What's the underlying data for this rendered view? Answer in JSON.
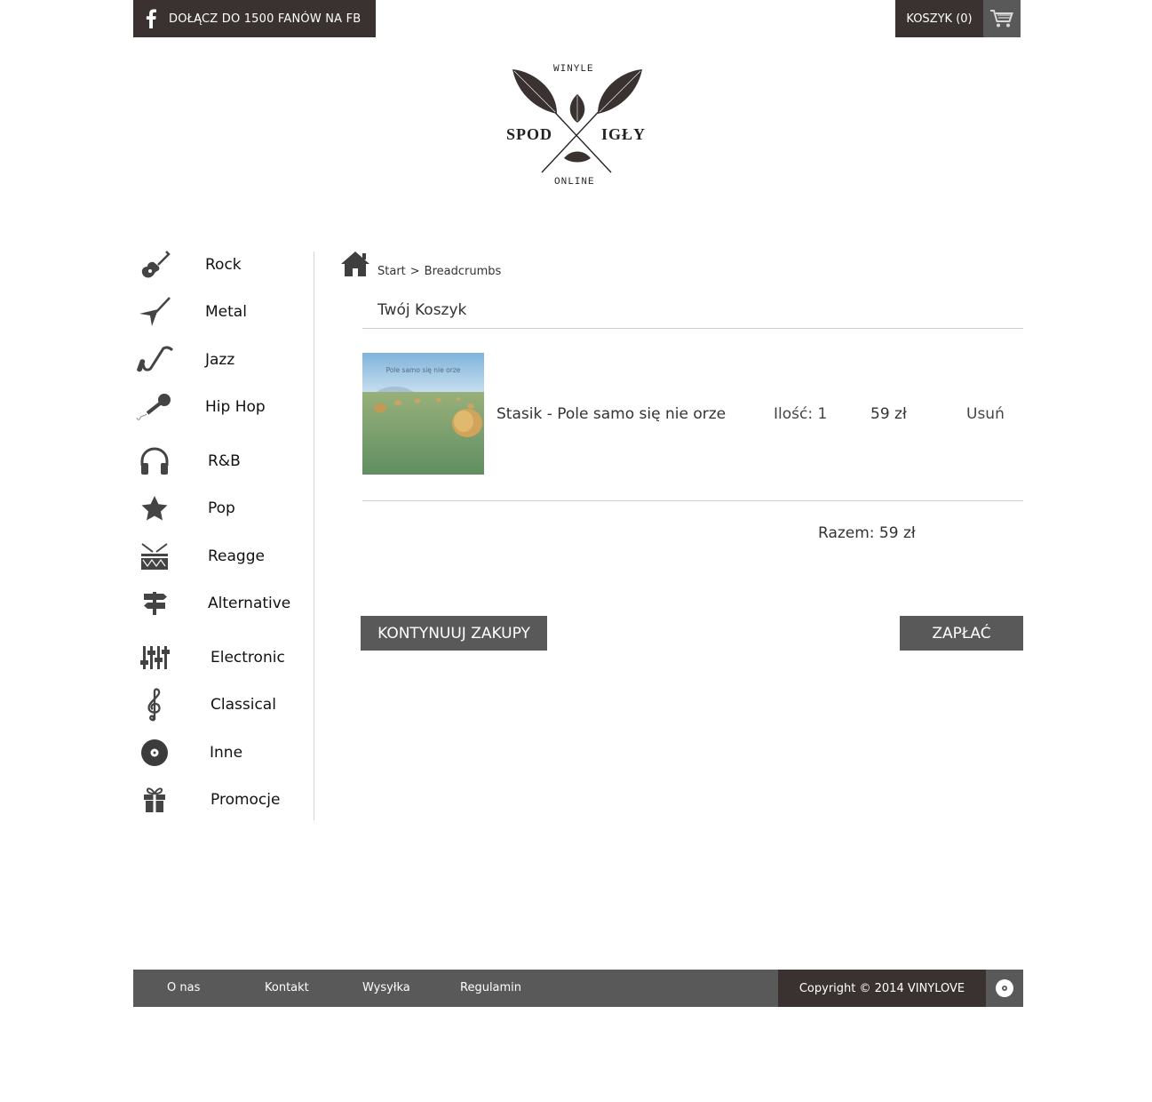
{
  "header": {
    "fb_label": "DOŁĄCZ DO 1500 FANÓW NA FB",
    "fb_icon": "facebook-icon",
    "cart_label": "KOSZYK (0)",
    "cart_icon": "shopping-cart-icon"
  },
  "logo": {
    "top": "WINYLE",
    "left": "SPOD",
    "right": "IGŁY",
    "bottom": "ONLINE"
  },
  "categories": [
    {
      "label": "Rock",
      "icon": "electric-guitar-icon"
    },
    {
      "label": "Metal",
      "icon": "flying-v-guitar-icon"
    },
    {
      "label": "Jazz",
      "icon": "saxophone-icon"
    },
    {
      "label": "Hip Hop",
      "icon": "microphone-icon"
    },
    {
      "label": "R&B",
      "icon": "headphones-icon"
    },
    {
      "label": "Pop",
      "icon": "star-icon"
    },
    {
      "label": "Reagge",
      "icon": "drum-icon"
    },
    {
      "label": "Alternative",
      "icon": "signpost-icon"
    },
    {
      "label": "Electronic",
      "icon": "equalizer-icon"
    },
    {
      "label": "Classical",
      "icon": "treble-clef-icon"
    },
    {
      "label": "Inne",
      "icon": "vinyl-disc-icon"
    },
    {
      "label": "Promocje",
      "icon": "gift-icon"
    }
  ],
  "breadcrumbs": {
    "home_icon": "home-icon",
    "start": "Start",
    "separator": ">",
    "current": "Breadcrumbs"
  },
  "cart": {
    "title": "Twój Koszyk",
    "items": [
      {
        "cover_text": "Pole samo się nie orze",
        "title": "Stasik - Pole samo się nie orze",
        "quantity": "Ilość: 1",
        "price": "59 zł",
        "remove": "Usuń"
      }
    ],
    "total": "Razem: 59 zł"
  },
  "actions": {
    "continue": "KONTYNUUJ ZAKUPY",
    "pay": "ZAPŁAĆ"
  },
  "footer": {
    "links": [
      "O nas",
      "Kontakt",
      "Wysyłka",
      "Regulamin"
    ],
    "copyright": "Copyright © 2014 VINYLOVE",
    "disc_icon": "vinyl-disc-icon"
  },
  "colors": {
    "dark_brown": "#3a3230",
    "gray": "#595959"
  }
}
